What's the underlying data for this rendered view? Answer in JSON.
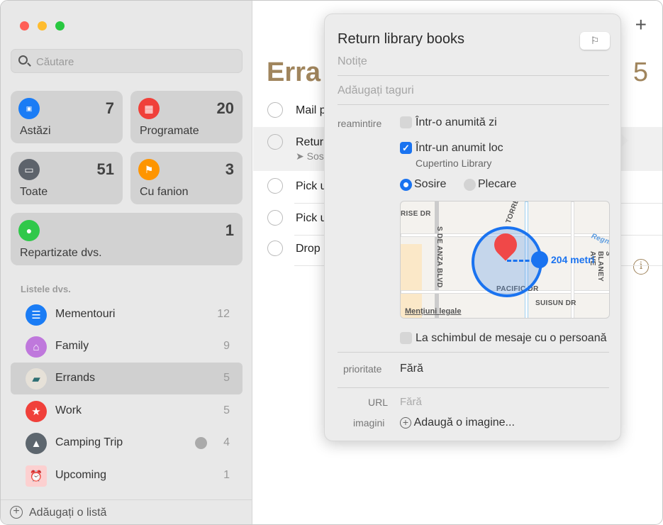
{
  "window": {
    "controls": {
      "close_color": "#ff5f57",
      "minimize_color": "#febc2e",
      "zoom_color": "#28c840"
    }
  },
  "sidebar": {
    "search_placeholder": "Căutare",
    "smart_lists": [
      {
        "label": "Astăzi",
        "count": "7",
        "icon": "calendar-today-icon",
        "color": "#1a7cf5"
      },
      {
        "label": "Programate",
        "count": "20",
        "icon": "calendar-icon",
        "color": "#f0403a"
      },
      {
        "label": "Toate",
        "count": "51",
        "icon": "tray-icon",
        "color": "#5d636b"
      },
      {
        "label": "Cu fanion",
        "count": "3",
        "icon": "flag-icon",
        "color": "#fe9500"
      },
      {
        "label": "Repartizate dvs.",
        "count": "1",
        "icon": "person-icon",
        "color": "#30c84a"
      }
    ],
    "section_title": "Listele dvs.",
    "lists": [
      {
        "label": "Mementouri",
        "count": "12",
        "icon": "list-icon",
        "color": "#1a7cf5"
      },
      {
        "label": "Family",
        "count": "9",
        "icon": "house-icon",
        "color": "#bf78dc"
      },
      {
        "label": "Errands",
        "count": "5",
        "icon": "truck-icon",
        "color": "#e6e1d8",
        "selected": true
      },
      {
        "label": "Work",
        "count": "5",
        "icon": "star-icon",
        "color": "#f0403a"
      },
      {
        "label": "Camping Trip",
        "count": "4",
        "icon": "tent-icon",
        "color": "#5d666e",
        "shared": true
      },
      {
        "label": "Upcoming",
        "count": "1",
        "icon": "alarm-clock-icon",
        "color": "#fcd0d0"
      }
    ],
    "add_list_label": "Adăugați o listă"
  },
  "main": {
    "title": "Erra",
    "count": "5",
    "accent": "#a0855d",
    "tasks": [
      {
        "title": "Mail p"
      },
      {
        "title": "Retur",
        "subtitle": "Sos",
        "selected": true
      },
      {
        "title": "Pick u"
      },
      {
        "title": "Pick u"
      },
      {
        "title": "Drop"
      }
    ]
  },
  "popover": {
    "title": "Return library books",
    "notes_placeholder": "Notițe",
    "tags_placeholder": "Adăugați taguri",
    "remind_label": "reamintire",
    "on_day_label": "Într-o anumită zi",
    "on_day_checked": false,
    "at_location_label": "Într-un anumit loc",
    "at_location_checked": true,
    "location_name": "Cupertino Library",
    "arriving_label": "Sosire",
    "leaving_label": "Plecare",
    "selected_trigger": "Sosire",
    "map": {
      "radius_label": "204 metri",
      "legal_label": "Mențiuni legale",
      "streets": [
        "RISE DR",
        "S DE ANZA BLVD",
        "TORRE",
        "PACIFIC DR",
        "SUISUN DR",
        "S BLANEY AVE",
        "Regnart"
      ]
    },
    "messaging_label": "La schimbul de mesaje cu o persoană",
    "messaging_checked": false,
    "priority_label": "prioritate",
    "priority_value": "Fără",
    "url_label": "URL",
    "url_value": "Fără",
    "images_label": "imagini",
    "add_image_label": "Adaugă o imagine..."
  }
}
